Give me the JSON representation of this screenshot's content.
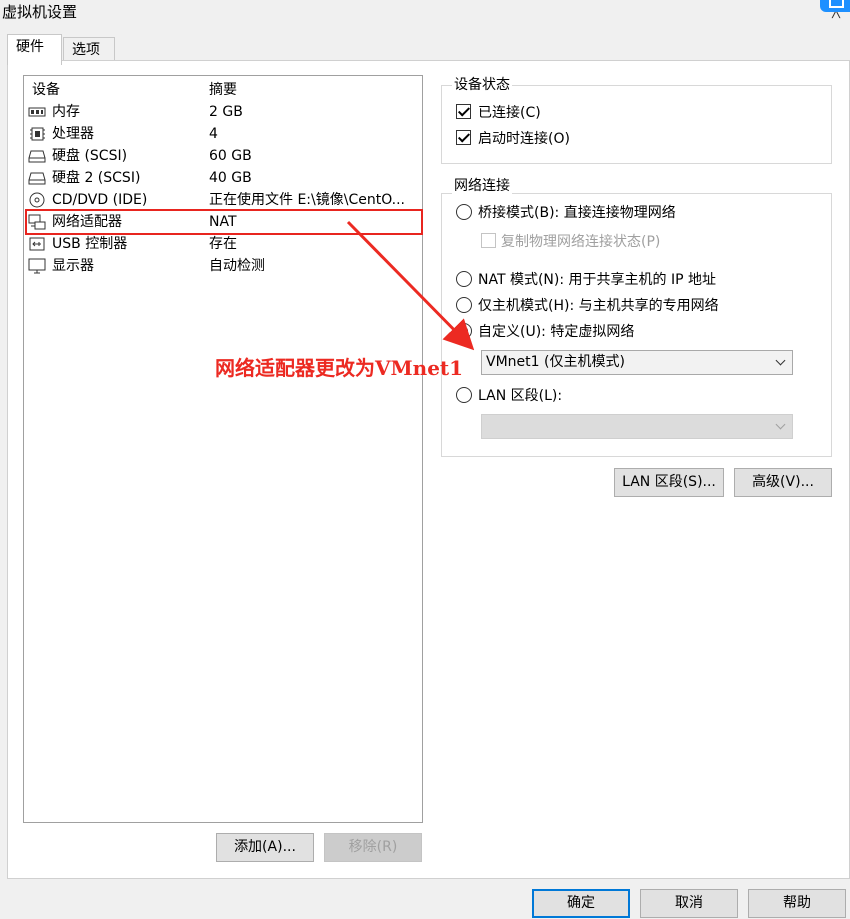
{
  "window": {
    "title": "虚拟机设置"
  },
  "tabs": [
    {
      "label": "硬件"
    },
    {
      "label": "选项"
    }
  ],
  "device_list": {
    "columns": [
      "设备",
      "摘要"
    ],
    "rows": [
      {
        "icon": "memory-icon",
        "device": "内存",
        "summary": "2 GB"
      },
      {
        "icon": "cpu-icon",
        "device": "处理器",
        "summary": "4"
      },
      {
        "icon": "disk-icon",
        "device": "硬盘 (SCSI)",
        "summary": "60 GB"
      },
      {
        "icon": "disk-icon",
        "device": "硬盘 2 (SCSI)",
        "summary": "40 GB"
      },
      {
        "icon": "cd-icon",
        "device": "CD/DVD (IDE)",
        "summary": "正在使用文件 E:\\镜像\\CentO..."
      },
      {
        "icon": "network-icon",
        "device": "网络适配器",
        "summary": "NAT"
      },
      {
        "icon": "usb-icon",
        "device": "USB 控制器",
        "summary": "存在"
      },
      {
        "icon": "monitor-icon",
        "device": "显示器",
        "summary": "自动检测"
      }
    ]
  },
  "left_buttons": {
    "add": "添加(A)...",
    "remove": "移除(R)"
  },
  "device_status": {
    "title": "设备状态",
    "connected": {
      "label": "已连接(C)",
      "checked": true
    },
    "connect_at_power_on": {
      "label": "启动时连接(O)",
      "checked": true
    }
  },
  "network_connection": {
    "title": "网络连接",
    "bridged": {
      "label": "桥接模式(B): 直接连接物理网络",
      "selected": false
    },
    "replicate": {
      "label": "复制物理网络连接状态(P)",
      "checked": false
    },
    "nat": {
      "label": "NAT 模式(N): 用于共享主机的 IP 地址",
      "selected": false
    },
    "host_only": {
      "label": "仅主机模式(H): 与主机共享的专用网络",
      "selected": false
    },
    "custom": {
      "label": "自定义(U): 特定虚拟网络",
      "selected": true
    },
    "custom_select": {
      "value": "VMnet1 (仅主机模式)"
    },
    "lan_segment": {
      "label": "LAN 区段(L):",
      "selected": false
    },
    "lan_select": {
      "value": ""
    }
  },
  "right_buttons": {
    "lan_segments": "LAN 区段(S)...",
    "advanced": "高级(V)..."
  },
  "dialog_buttons": {
    "ok": "确定",
    "cancel": "取消",
    "help": "帮助"
  },
  "annotation": {
    "text": "网络适配器更改为VMnet1",
    "color": "#ec2a22"
  }
}
